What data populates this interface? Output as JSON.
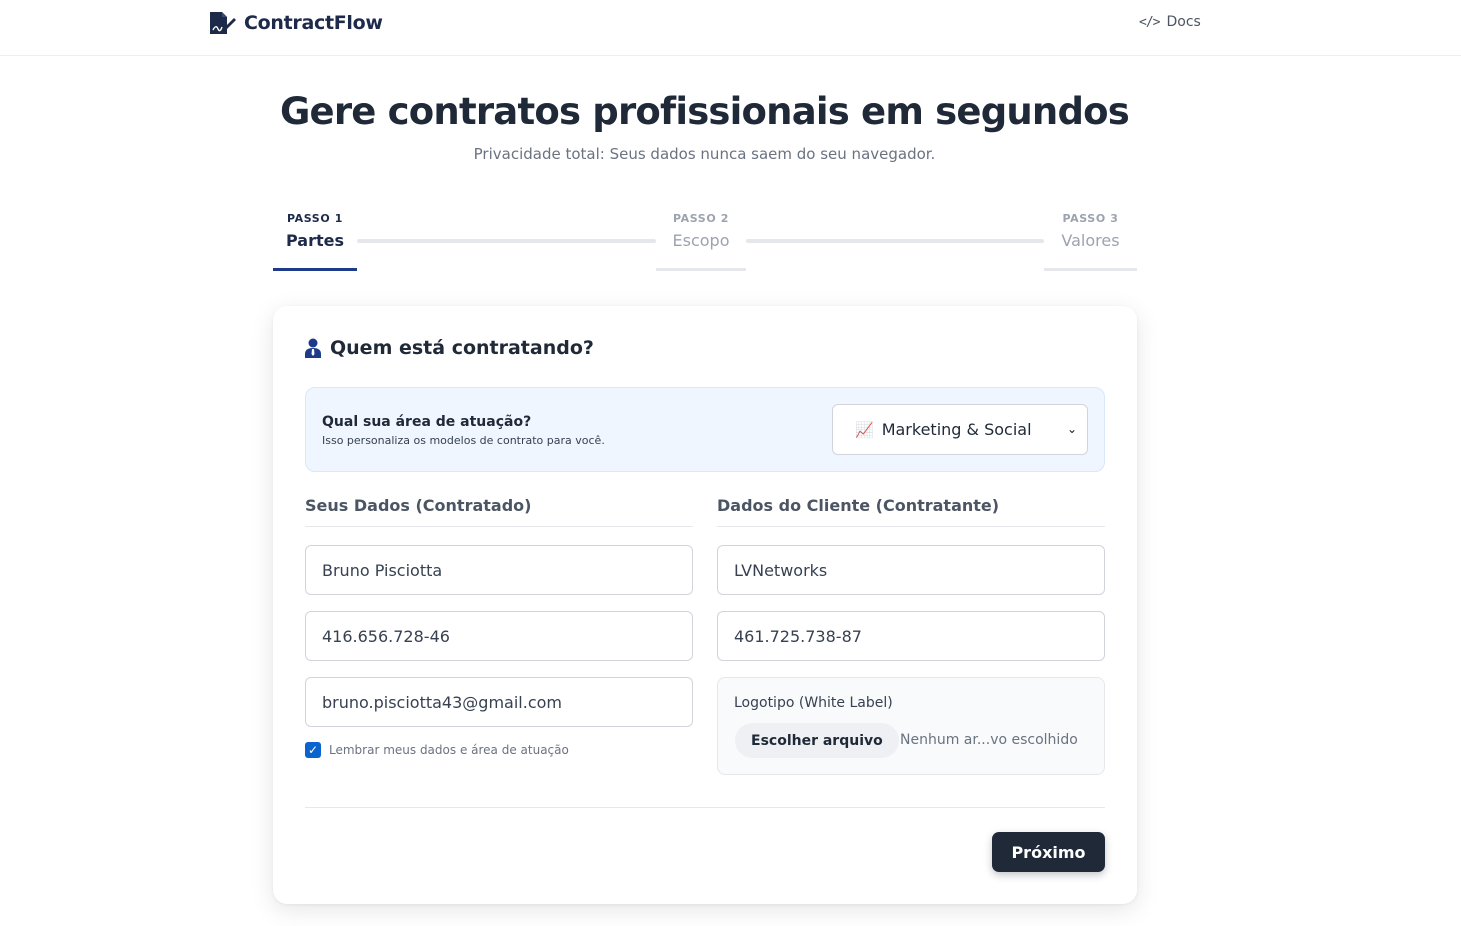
{
  "nav": {
    "brand": "ContractFlow",
    "brand_icon": "contract-pen-icon",
    "docs_label": "Docs",
    "docs_icon": "code-icon"
  },
  "hero": {
    "title": "Gere contratos profissionais em segundos",
    "subtitle": "Privacidade total: Seus dados nunca saem do seu navegador."
  },
  "stepper": {
    "steps": [
      {
        "kicker": "PASSO 1",
        "label": "Partes",
        "active": true
      },
      {
        "kicker": "PASSO 2",
        "label": "Escopo",
        "active": false
      },
      {
        "kicker": "PASSO 3",
        "label": "Valores",
        "active": false
      }
    ]
  },
  "card": {
    "title": "Quem está contratando?",
    "title_icon": "person-icon",
    "area": {
      "question": "Qual sua área de atuação?",
      "hint": "Isso personaliza os modelos de contrato para você.",
      "selected_emoji": "📈",
      "selected": "Marketing & Social"
    },
    "contractor": {
      "heading": "Seus Dados (Contratado)",
      "name": "Bruno Pisciotta",
      "document": "416.656.728-46",
      "email": "bruno.pisciotta43@gmail.com",
      "remember_label": "Lembrar meus dados e área de atuação",
      "remember_checked": true
    },
    "client": {
      "heading": "Dados do Cliente (Contratante)",
      "name": "LVNetworks",
      "document": "461.725.738-87",
      "logo_label": "Logotipo (White Label)",
      "file_button": "Escolher arquivo",
      "file_status": "Nenhum ar...vo escolhido"
    },
    "next_label": "Próximo"
  },
  "colors": {
    "primary_dark": "#1f2937",
    "accent_navy": "#1e3a8a",
    "info_bg": "#eff6ff",
    "checkbox": "#0b63ce"
  }
}
